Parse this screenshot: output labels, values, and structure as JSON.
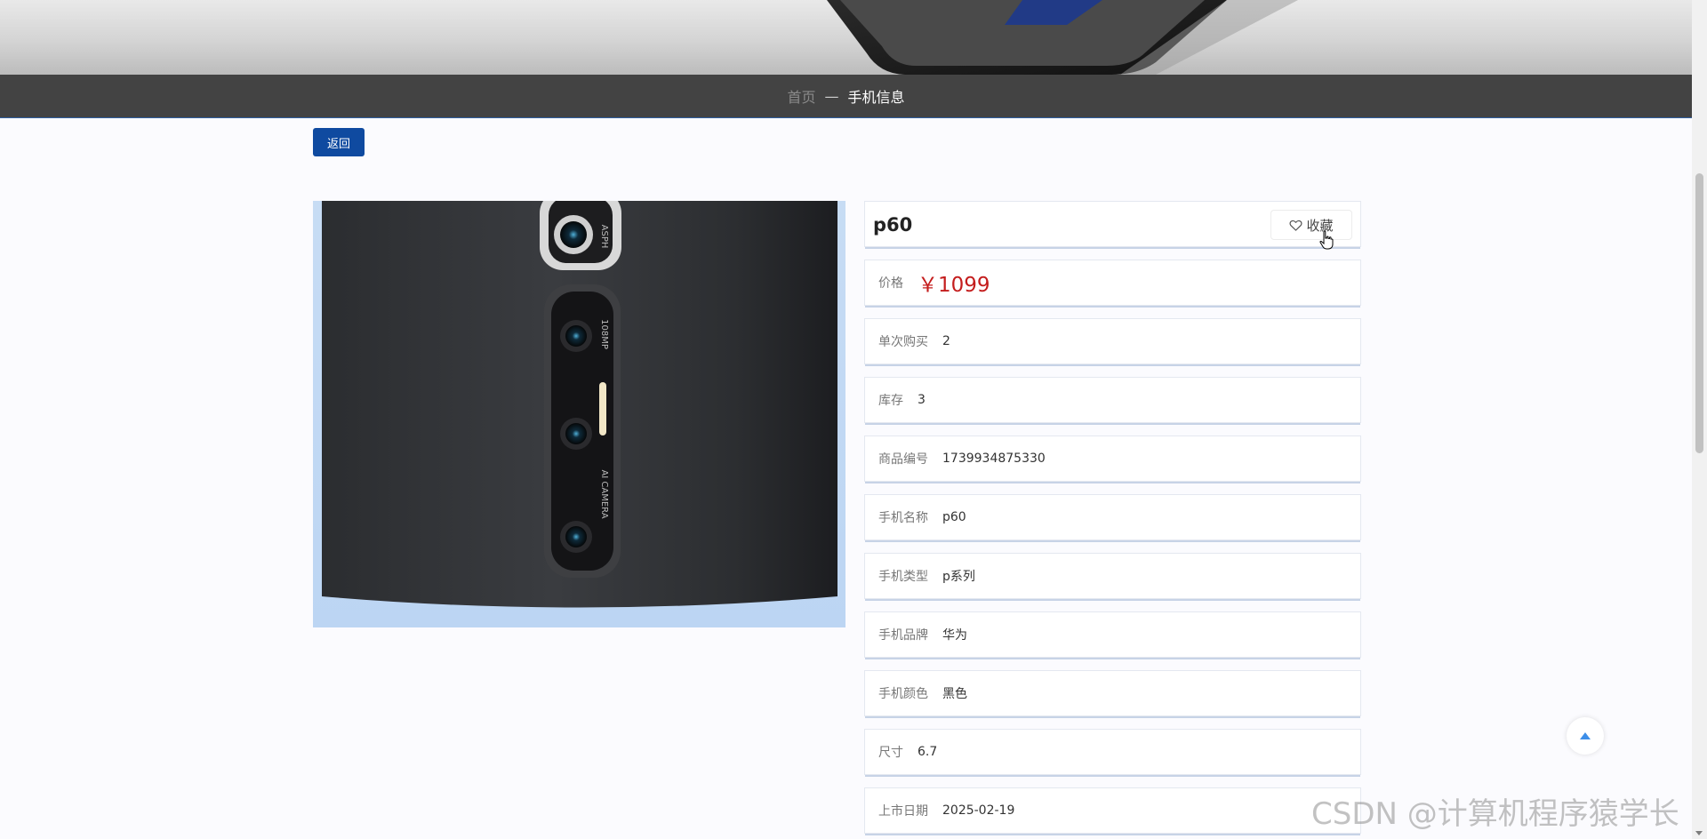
{
  "breadcrumb": {
    "home": "首页",
    "separator": "—",
    "current": "手机信息"
  },
  "back_button": {
    "label": "返回"
  },
  "product": {
    "title": "p60",
    "favorite_label": "收藏",
    "fields": [
      {
        "key": "price",
        "label": "价格",
        "value": "￥1099"
      },
      {
        "key": "per_purchase",
        "label": "单次购买",
        "value": "2"
      },
      {
        "key": "stock",
        "label": "库存",
        "value": "3"
      },
      {
        "key": "product_code",
        "label": "商品编号",
        "value": "1739934875330"
      },
      {
        "key": "phone_name",
        "label": "手机名称",
        "value": "p60"
      },
      {
        "key": "phone_type",
        "label": "手机类型",
        "value": "p系列"
      },
      {
        "key": "phone_brand",
        "label": "手机品牌",
        "value": "华为"
      },
      {
        "key": "phone_color",
        "label": "手机颜色",
        "value": "黑色"
      },
      {
        "key": "size",
        "label": "尺寸",
        "value": "6.7"
      },
      {
        "key": "release_date",
        "label": "上市日期",
        "value": "2025-02-19"
      }
    ],
    "camera_labels": [
      "ASPH",
      "108MP",
      "AI CAMERA"
    ]
  },
  "watermark": "CSDN @计算机程序猿学长",
  "colors": {
    "accent": "#0f4aa0",
    "price": "#c41d1d",
    "breadcrumb_bar": "#434343",
    "back_to_top_arrow": "#3d8ee8"
  },
  "icons": {
    "favorite": "heart-icon",
    "back_to_top": "triangle-up-icon",
    "pointer": "hand-cursor-icon"
  }
}
